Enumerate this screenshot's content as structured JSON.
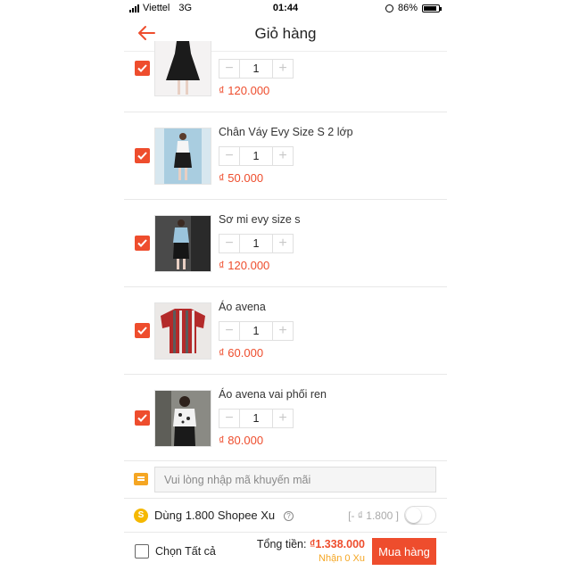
{
  "status_bar": {
    "carrier": "Viettel",
    "network": "3G",
    "time": "01:44",
    "battery": "86%",
    "battery_level": 0.86
  },
  "header": {
    "title": "Giỏ hàng",
    "accent": "#ee4d2d"
  },
  "items": [
    {
      "name": "",
      "quantity": "1",
      "price": "₫ 120.000",
      "checked": true
    },
    {
      "name": "Chân Váy Evy Size S 2 lớp",
      "quantity": "1",
      "price": "₫ 50.000",
      "checked": true
    },
    {
      "name": "Sơ mi evy size s",
      "quantity": "1",
      "price": "₫ 120.000",
      "checked": true
    },
    {
      "name": "Áo avena",
      "quantity": "1",
      "price": "₫ 60.000",
      "checked": true
    },
    {
      "name": "Áo avena vai phối ren",
      "quantity": "1",
      "price": "₫ 80.000",
      "checked": true
    }
  ],
  "qty_controls": {
    "minus": "−",
    "plus": "+"
  },
  "voucher": {
    "placeholder": "Vui lòng nhập mã khuyến mãi"
  },
  "coins": {
    "label": "Dùng 1.800 Shopee Xu",
    "help": "?",
    "discount": "[- ₫ 1.800 ]",
    "coin_symbol": "S",
    "enabled": false
  },
  "footer": {
    "select_all": "Chọn Tất cả",
    "total_label": "Tổng tiền:",
    "total_value": "₫1.338.000",
    "coins_earned": "Nhận 0 Xu",
    "buy_label": "Mua hàng"
  }
}
